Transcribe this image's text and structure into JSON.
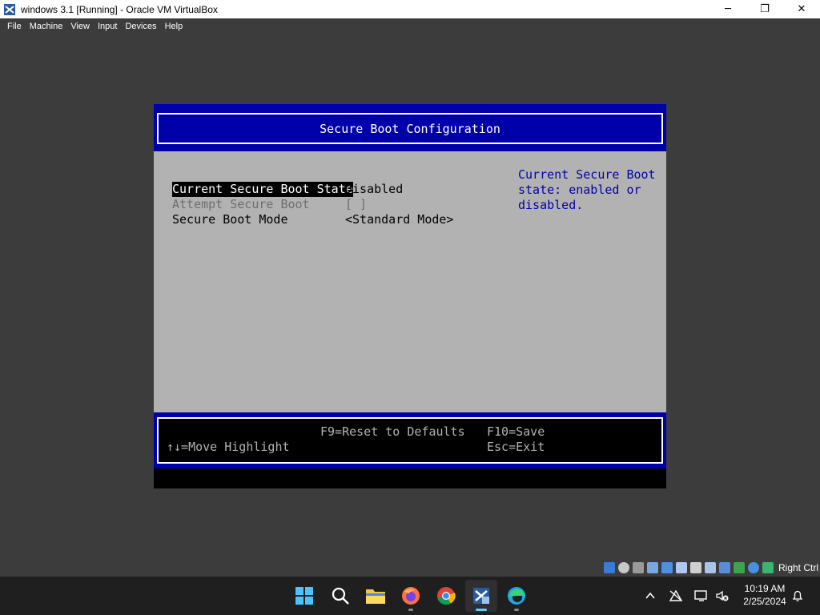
{
  "window": {
    "title": "windows 3.1 [Running] - Oracle VM VirtualBox",
    "minimize_glyph": "─",
    "maximize_glyph": "❐",
    "close_glyph": "✕"
  },
  "menu": {
    "items": [
      "File",
      "Machine",
      "View",
      "Input",
      "Devices",
      "Help"
    ]
  },
  "bios": {
    "title": "Secure Boot Configuration",
    "options": [
      {
        "label": "Current Secure Boot State",
        "value": "Disabled",
        "state": "selected"
      },
      {
        "label": "Attempt Secure Boot",
        "value": "[ ]",
        "state": "disabled"
      },
      {
        "label": "Secure Boot Mode",
        "value": "<Standard Mode>",
        "state": "normal"
      }
    ],
    "help_lines": [
      "Current Secure Boot",
      "state: enabled or",
      "disabled."
    ],
    "footer": {
      "reset": "F9=Reset to Defaults",
      "save": "F10=Save",
      "move": "↑↓=Move Highlight",
      "exit": "Esc=Exit"
    }
  },
  "statusbar": {
    "host_key": "Right Ctrl",
    "icons": [
      "hard-disk-icon",
      "optical-drive-icon",
      "floppy-icon",
      "audio-icon",
      "network-icon",
      "usb-icon",
      "shared-folders-icon",
      "display-icon",
      "recording-icon",
      "cpu-icon",
      "guest-additions-icon",
      "mouse-integration-icon"
    ]
  },
  "taskbar": {
    "apps": [
      "start-icon",
      "search-icon",
      "file-explorer-icon",
      "firefox-icon",
      "chrome-icon",
      "virtualbox-icon",
      "edge-icon"
    ],
    "time": "10:19 AM",
    "date": "2/25/2024"
  },
  "colors": {
    "bios_blue": "#0000aa",
    "bios_grey": "#b2b2b2",
    "accent": "#60cdff"
  }
}
